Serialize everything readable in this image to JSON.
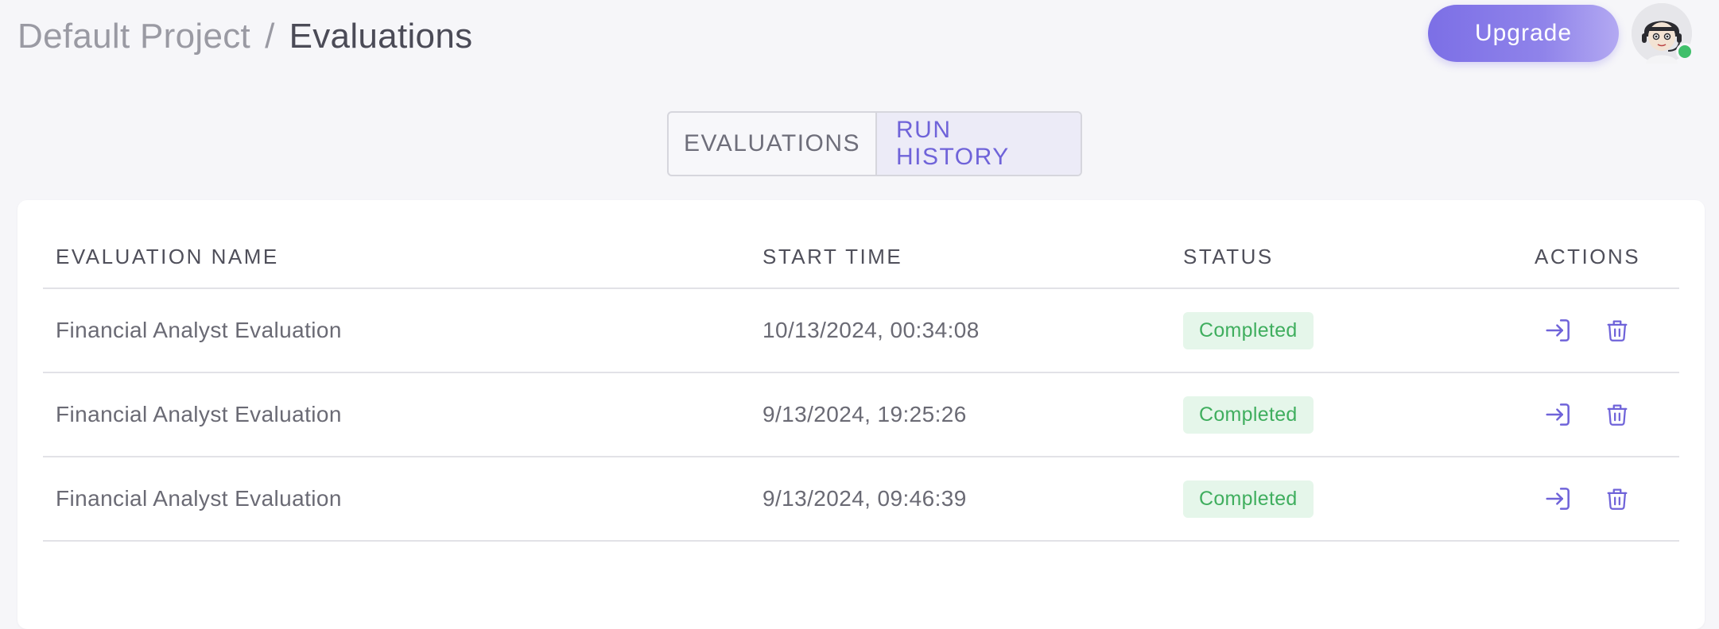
{
  "header": {
    "breadcrumb_parent": "Default Project",
    "breadcrumb_separator": "/",
    "breadcrumb_current": "Evaluations",
    "upgrade_label": "Upgrade",
    "avatar_icon": "user-avatar-icon",
    "presence_color": "#3fbf6a"
  },
  "tabs": [
    {
      "label": "EVALUATIONS",
      "active": false
    },
    {
      "label": "RUN HISTORY",
      "active": true
    }
  ],
  "table": {
    "columns": [
      "EVALUATION NAME",
      "START TIME",
      "STATUS",
      "ACTIONS"
    ],
    "rows": [
      {
        "name": "Financial Analyst Evaluation",
        "start_time": "10/13/2024, 00:34:08",
        "status": "Completed"
      },
      {
        "name": "Financial Analyst Evaluation",
        "start_time": "9/13/2024, 19:25:26",
        "status": "Completed"
      },
      {
        "name": "Financial Analyst Evaluation",
        "start_time": "9/13/2024, 09:46:39",
        "status": "Completed"
      }
    ],
    "action_icons": [
      "open-icon",
      "trash-icon"
    ]
  },
  "colors": {
    "accent": "#6f63d9",
    "status_completed_bg": "#e5f6ea",
    "status_completed_text": "#3fae5e"
  }
}
